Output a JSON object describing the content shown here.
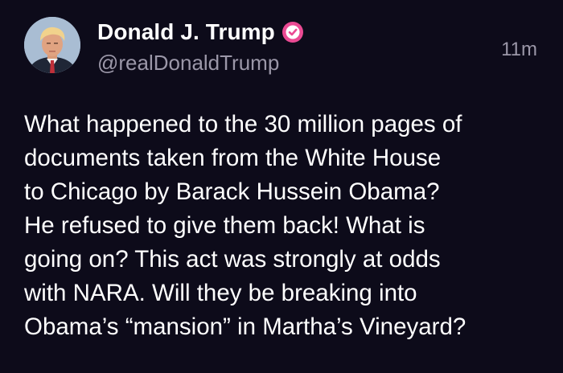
{
  "author": {
    "display_name": "Donald J. Trump",
    "handle": "@realDonaldTrump",
    "verified": true,
    "verified_icon": "verified-badge-icon",
    "avatar_icon": "profile-photo"
  },
  "post": {
    "timestamp": "11m",
    "lines": [
      "What happened to the 30 million pages of",
      "documents taken from the White House",
      "to Chicago by Barack Hussein Obama?",
      "He refused to give them back! What is",
      "going on? This act was strongly at odds",
      "with NARA. Will they be breaking into",
      "Obama’s “mansion” in Martha’s Vineyard?"
    ]
  },
  "colors": {
    "background": "#0d0b1a",
    "text": "#ffffff",
    "secondary_text": "#9b97a8",
    "verified_badge": "#ea4a93"
  }
}
